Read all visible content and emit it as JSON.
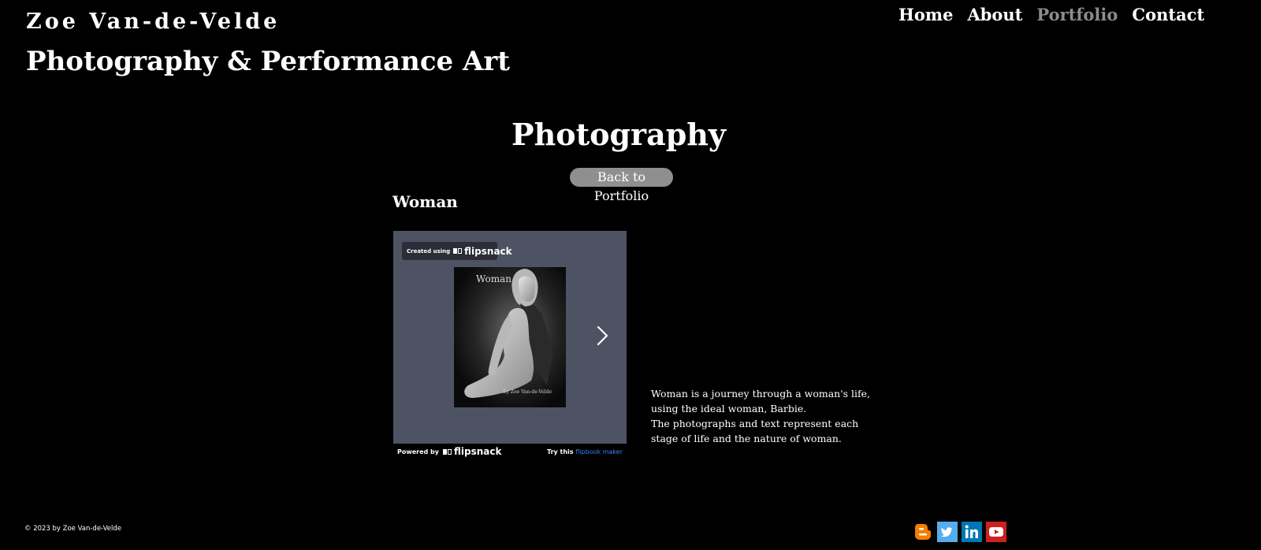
{
  "header": {
    "site_name": "Zoe Van-de-Velde",
    "tagline": "Photography & Performance Art"
  },
  "nav": {
    "items": [
      {
        "label": "Home",
        "active": false
      },
      {
        "label": "About",
        "active": false
      },
      {
        "label": "Portfolio",
        "active": true
      },
      {
        "label": "Contact",
        "active": false
      }
    ]
  },
  "main": {
    "title": "Photography",
    "back_button": "Back to Portfolio",
    "section_heading": "Woman",
    "flipbook": {
      "created_using": "Created using",
      "brand": "flipsnack",
      "cover_title": "Woman",
      "cover_credit": "By Zoe Van-de-Velde",
      "powered_by": "Powered by",
      "try_this": "Try this",
      "flipbook_maker": "flipbook maker"
    },
    "description": [
      "Woman is a journey through a woman's life,",
      "using the ideal woman, Barbie.",
      "The photographs and text represent each",
      "stage of life and the nature of woman."
    ]
  },
  "footer": {
    "copyright": "© 2023 by Zoe Van-de-Velde",
    "social": [
      {
        "name": "blogger",
        "icon": "blogger-icon",
        "color": "#f57d00"
      },
      {
        "name": "twitter",
        "icon": "twitter-icon",
        "color": "#55acee"
      },
      {
        "name": "linkedin",
        "icon": "linkedin-icon",
        "color": "#0077b5"
      },
      {
        "name": "youtube",
        "icon": "youtube-icon",
        "color": "#cd201f"
      }
    ]
  },
  "colors": {
    "background": "#000000",
    "nav_active": "#8c8c8c",
    "flipbook_bg": "#4d5363",
    "button_bg": "#8f8f8f",
    "link_blue": "#3b82f6"
  }
}
